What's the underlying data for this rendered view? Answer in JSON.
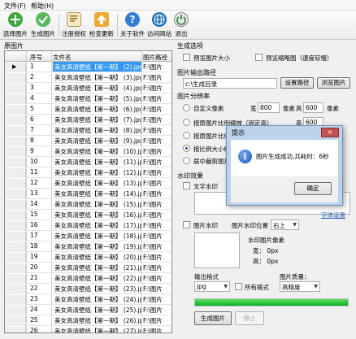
{
  "menu": {
    "file": "文件(F)",
    "help": "帮助(H)"
  },
  "toolbar": {
    "select_images": "选择图片",
    "generate_images": "生成图片",
    "register": "注册授权",
    "check_update": "检查更新",
    "about": "关于软件",
    "visit_site": "访问网站",
    "exit": "退出"
  },
  "left": {
    "title": "原图片",
    "columns": {
      "num": "序号",
      "name": "文件名",
      "path": "图片路径"
    },
    "rows": [
      {
        "num": "1",
        "name": "美女高清壁纸【第一期】 (2).jpg",
        "path": "F:\\图片"
      },
      {
        "num": "2",
        "name": "美女高清壁纸【第一期】 (3).jpg",
        "path": "F:\\图片"
      },
      {
        "num": "3",
        "name": "美女高清壁纸【第一期】 (4).jpg",
        "path": "F:\\图片"
      },
      {
        "num": "4",
        "name": "美女高清壁纸【第一期】 (5).jpg",
        "path": "F:\\图片"
      },
      {
        "num": "5",
        "name": "美女高清壁纸【第一期】 (6).jpg",
        "path": "F:\\图片"
      },
      {
        "num": "6",
        "name": "美女高清壁纸【第一期】 (7).jpg",
        "path": "F:\\图片"
      },
      {
        "num": "7",
        "name": "美女高清壁纸【第一期】 (8).jpg",
        "path": "F:\\图片"
      },
      {
        "num": "8",
        "name": "美女高清壁纸【第一期】 (9).jpg",
        "path": "F:\\图片"
      },
      {
        "num": "9",
        "name": "美女高清壁纸【第一期】 (10).jpg",
        "path": "F:\\图片"
      },
      {
        "num": "10",
        "name": "美女高清壁纸【第一期】 (11).jpg",
        "path": "F:\\图片"
      },
      {
        "num": "11",
        "name": "美女高清壁纸【第一期】 (12).jpg",
        "path": "F:\\图片"
      },
      {
        "num": "12",
        "name": "美女高清壁纸【第一期】 (13).jpg",
        "path": "F:\\图片"
      },
      {
        "num": "13",
        "name": "美女高清壁纸【第一期】 (14).jpg",
        "path": "F:\\图片"
      },
      {
        "num": "14",
        "name": "美女高清壁纸【第一期】 (15).jpg",
        "path": "F:\\图片"
      },
      {
        "num": "15",
        "name": "美女高清壁纸【第一期】 (16).jpg",
        "path": "F:\\图片"
      },
      {
        "num": "16",
        "name": "美女高清壁纸【第一期】 (17).jpg",
        "path": "F:\\图片"
      },
      {
        "num": "17",
        "name": "美女高清壁纸【第一期】 (18).jpg",
        "path": "F:\\图片"
      },
      {
        "num": "18",
        "name": "美女高清壁纸【第一期】 (19).jpg",
        "path": "F:\\图片"
      },
      {
        "num": "19",
        "name": "美女高清壁纸【第一期】 (20).jpg",
        "path": "F:\\图片"
      },
      {
        "num": "20",
        "name": "美女高清壁纸【第一期】 (21).jpg",
        "path": "F:\\图片"
      },
      {
        "num": "21",
        "name": "美女高清壁纸【第一期】 (22).jpg",
        "path": "F:\\图片"
      },
      {
        "num": "22",
        "name": "美女高清壁纸【第一期】 (23).jpg",
        "path": "F:\\图片"
      },
      {
        "num": "23",
        "name": "美女高清壁纸【第一期】 (24).jpg",
        "path": "F:\\图片"
      },
      {
        "num": "24",
        "name": "美女高清壁纸【第一期】 (25).jpg",
        "path": "F:\\图片"
      },
      {
        "num": "25",
        "name": "美女高清壁纸【第一期】 (26).jpg",
        "path": "F:\\图片"
      },
      {
        "num": "26",
        "name": "美女高清壁纸【第一期】 (27).jpg",
        "path": "F:\\图片"
      }
    ]
  },
  "right": {
    "gen_options_title": "生成选项",
    "preview_image": "预览图片大小",
    "preview_thumb": "预览缩略图（速度较慢）",
    "output_path_label": "图片输出路径",
    "output_path": "c:\\生成目录",
    "set_path": "设置路径",
    "browse_images": "浏览图片",
    "resolution_title": "图片分辨率",
    "custom_size": "自定义像素",
    "width_label": "宽",
    "width_value": "800",
    "px": "像素",
    "height_label": "高",
    "height_value": "600",
    "keep_ratio": "按原图片比例缩放（固定高）",
    "keep_ratio_height_label": "高",
    "keep_ratio_height_value": "600",
    "orig_ratio": "按原图片比例",
    "scale": "按比例大小缩",
    "center_crop": "居中裁剪图片",
    "watermark_title": "水印效果",
    "text_watermark": "文字水印",
    "font_setting": "字体设置",
    "image_watermark": "图片水印",
    "wm_position_label": "图片水印位置",
    "wm_position": "右上",
    "wm_pixels_title": "水印图片像素",
    "wm_width": "宽：  0px",
    "wm_height": "高：  0px",
    "output_format_label": "输出格式",
    "output_format": "jpg",
    "all_formats": "所有格式",
    "quality_label": "图片质量：",
    "quality": "高精度",
    "generate_button": "生成图片",
    "stop_button": "停止",
    "progress": 1.0
  },
  "dialog": {
    "title": "提示",
    "close": "×",
    "message": "图片生成成功,共耗时：6秒",
    "ok": "确定"
  }
}
